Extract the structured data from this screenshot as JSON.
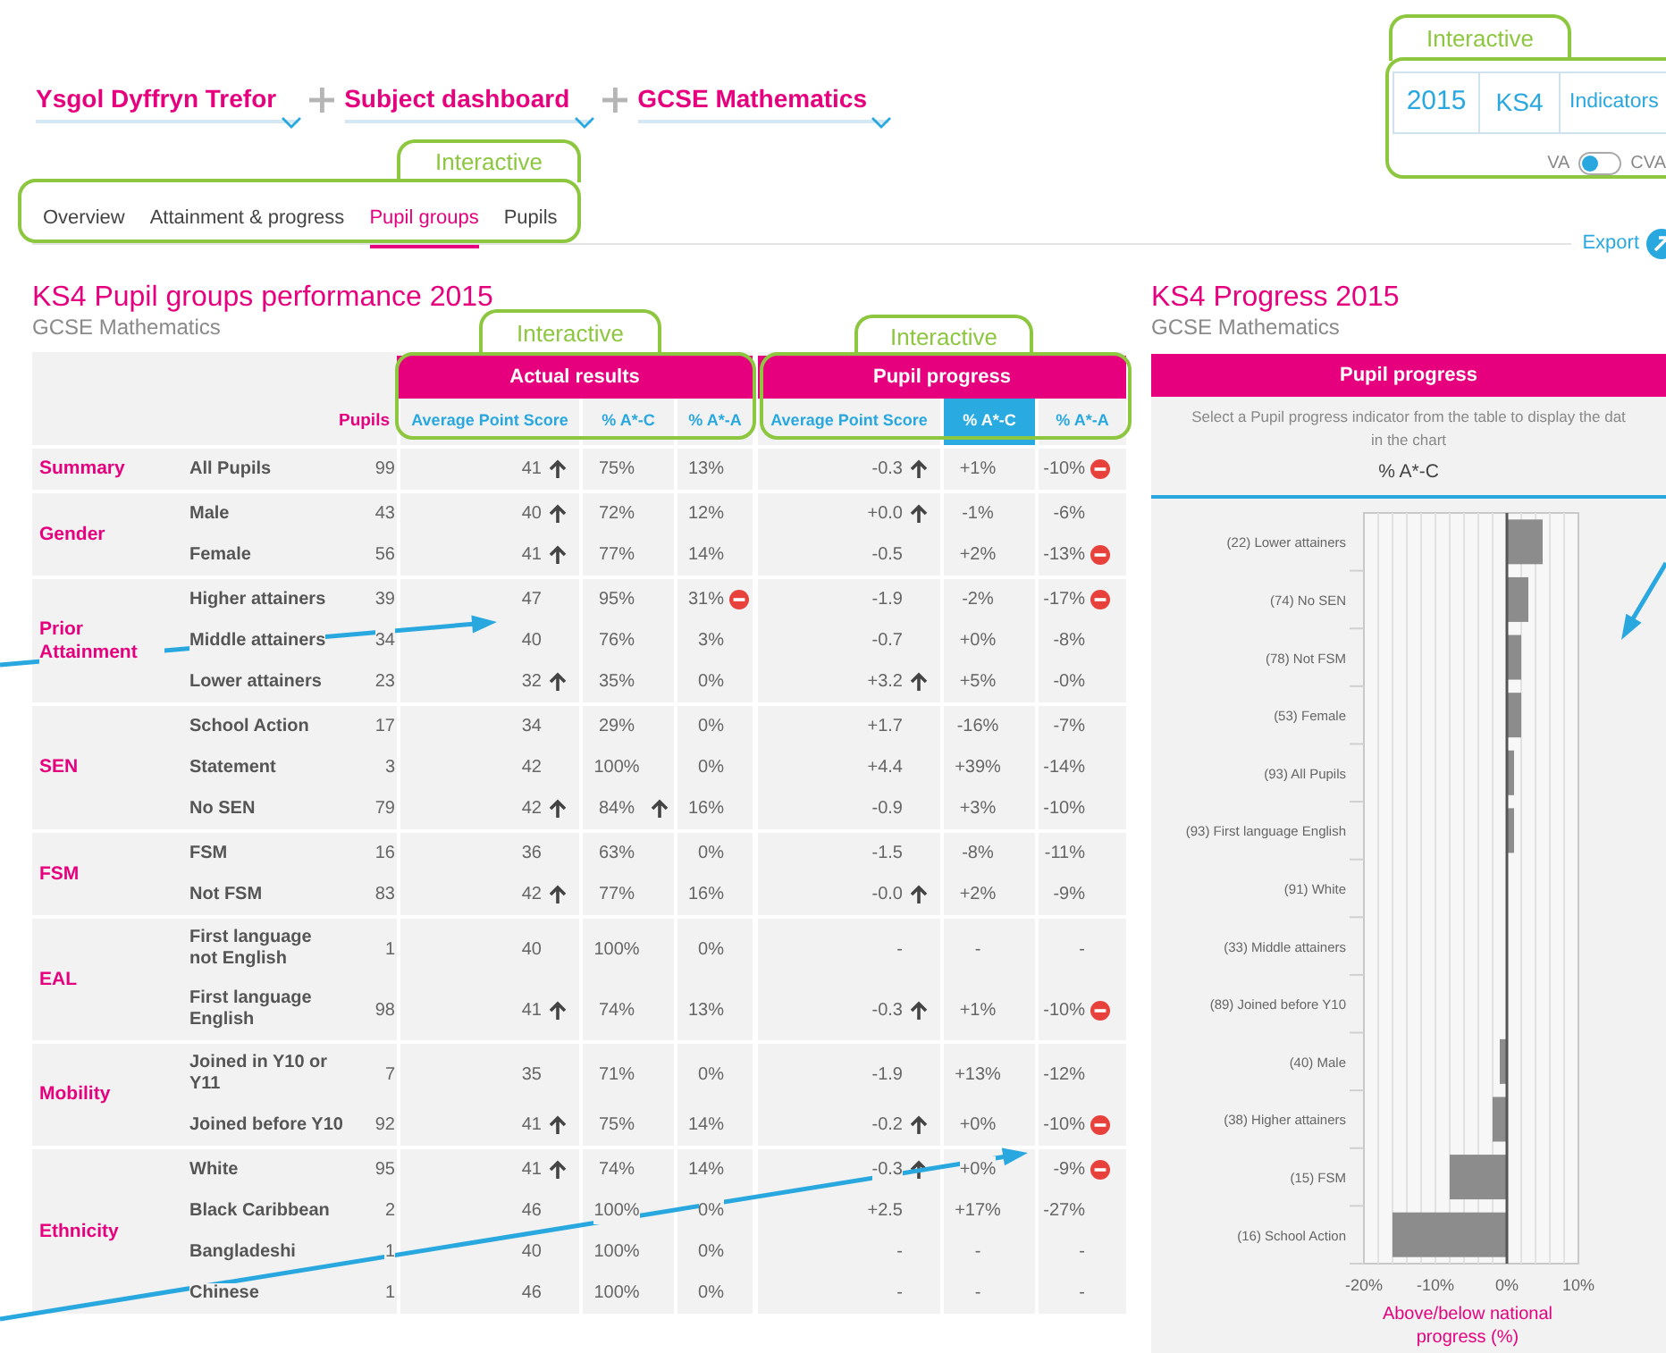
{
  "breadcrumb": [
    {
      "label": "Ysgol Dyffryn Trefor"
    },
    {
      "label": "Subject dashboard"
    },
    {
      "label": "GCSE Mathematics"
    }
  ],
  "filters": {
    "year": "2015",
    "stage": "KS4",
    "indicators": "Indicators",
    "toggle": {
      "left_label": "VA",
      "right_label": "CVA",
      "cva": false
    }
  },
  "tabs": [
    {
      "label": "Overview",
      "selected": false
    },
    {
      "label": "Attainment & progress",
      "selected": false
    },
    {
      "label": "Pupil groups",
      "selected": true
    },
    {
      "label": "Pupils",
      "selected": false
    }
  ],
  "export": "Export",
  "left_panel": {
    "title": "KS4 Pupil groups performance 2015",
    "subtitle": "GCSE Mathematics",
    "table": {
      "group_headers": [
        {
          "label": "Actual results"
        },
        {
          "label": "Pupil progress"
        }
      ],
      "pupils_header": "Pupils",
      "columns": [
        {
          "label": "Average Point Score",
          "selected": false
        },
        {
          "label": "% A*-C",
          "selected": false
        },
        {
          "label": "% A*-A",
          "selected": false
        },
        {
          "label": "Average Point Score",
          "selected": false
        },
        {
          "label": "% A*-C",
          "selected": true
        },
        {
          "label": "% A*-A",
          "selected": false
        }
      ],
      "groups": [
        {
          "label": "Summary",
          "rows": [
            {
              "name": "All Pupils",
              "pupils": "99",
              "cells": [
                {
                  "text": "41",
                  "up": true,
                  "alert": false
                },
                {
                  "text": "75%",
                  "up": false,
                  "alert": false
                },
                {
                  "text": "13%",
                  "up": false,
                  "alert": false
                },
                {
                  "text": "-0.3",
                  "up": true,
                  "alert": false
                },
                {
                  "text": "+1%",
                  "up": false,
                  "alert": false
                },
                {
                  "text": "-10%",
                  "up": false,
                  "alert": true
                }
              ]
            }
          ]
        },
        {
          "label": "Gender",
          "rows": [
            {
              "name": "Male",
              "pupils": "43",
              "cells": [
                {
                  "text": "40",
                  "up": true,
                  "alert": false
                },
                {
                  "text": "72%",
                  "up": false,
                  "alert": false
                },
                {
                  "text": "12%",
                  "up": false,
                  "alert": false
                },
                {
                  "text": "+0.0",
                  "up": true,
                  "alert": false
                },
                {
                  "text": "-1%",
                  "up": false,
                  "alert": false
                },
                {
                  "text": "-6%",
                  "up": false,
                  "alert": false
                }
              ]
            },
            {
              "name": "Female",
              "pupils": "56",
              "cells": [
                {
                  "text": "41",
                  "up": true,
                  "alert": false
                },
                {
                  "text": "77%",
                  "up": false,
                  "alert": false
                },
                {
                  "text": "14%",
                  "up": false,
                  "alert": false
                },
                {
                  "text": "-0.5",
                  "up": false,
                  "alert": false
                },
                {
                  "text": "+2%",
                  "up": false,
                  "alert": false
                },
                {
                  "text": "-13%",
                  "up": false,
                  "alert": true
                }
              ]
            }
          ]
        },
        {
          "label": "Prior Attainment",
          "rows": [
            {
              "name": "Higher attainers",
              "pupils": "39",
              "cells": [
                {
                  "text": "47",
                  "up": false,
                  "alert": false
                },
                {
                  "text": "95%",
                  "up": false,
                  "alert": false
                },
                {
                  "text": "31%",
                  "up": false,
                  "alert": true
                },
                {
                  "text": "-1.9",
                  "up": false,
                  "alert": false
                },
                {
                  "text": "-2%",
                  "up": false,
                  "alert": false
                },
                {
                  "text": "-17%",
                  "up": false,
                  "alert": true
                }
              ]
            },
            {
              "name": "Middle attainers",
              "pupils": "34",
              "cells": [
                {
                  "text": "40",
                  "up": false,
                  "alert": false
                },
                {
                  "text": "76%",
                  "up": false,
                  "alert": false
                },
                {
                  "text": "3%",
                  "up": false,
                  "alert": false
                },
                {
                  "text": "-0.7",
                  "up": false,
                  "alert": false
                },
                {
                  "text": "+0%",
                  "up": false,
                  "alert": false
                },
                {
                  "text": "-8%",
                  "up": false,
                  "alert": false
                }
              ]
            },
            {
              "name": "Lower attainers",
              "pupils": "23",
              "cells": [
                {
                  "text": "32",
                  "up": true,
                  "alert": false
                },
                {
                  "text": "35%",
                  "up": false,
                  "alert": false
                },
                {
                  "text": "0%",
                  "up": false,
                  "alert": false
                },
                {
                  "text": "+3.2",
                  "up": true,
                  "alert": false
                },
                {
                  "text": "+5%",
                  "up": false,
                  "alert": false
                },
                {
                  "text": "-0%",
                  "up": false,
                  "alert": false
                }
              ]
            }
          ]
        },
        {
          "label": "SEN",
          "rows": [
            {
              "name": "School Action",
              "pupils": "17",
              "cells": [
                {
                  "text": "34",
                  "up": false,
                  "alert": false
                },
                {
                  "text": "29%",
                  "up": false,
                  "alert": false
                },
                {
                  "text": "0%",
                  "up": false,
                  "alert": false
                },
                {
                  "text": "+1.7",
                  "up": false,
                  "alert": false
                },
                {
                  "text": "-16%",
                  "up": false,
                  "alert": false
                },
                {
                  "text": "-7%",
                  "up": false,
                  "alert": false
                }
              ]
            },
            {
              "name": "Statement",
              "pupils": "3",
              "cells": [
                {
                  "text": "42",
                  "up": false,
                  "alert": false
                },
                {
                  "text": "100%",
                  "up": false,
                  "alert": false
                },
                {
                  "text": "0%",
                  "up": false,
                  "alert": false
                },
                {
                  "text": "+4.4",
                  "up": false,
                  "alert": false
                },
                {
                  "text": "+39%",
                  "up": false,
                  "alert": false
                },
                {
                  "text": "-14%",
                  "up": false,
                  "alert": false
                }
              ]
            },
            {
              "name": "No SEN",
              "pupils": "79",
              "cells": [
                {
                  "text": "42",
                  "up": true,
                  "alert": false
                },
                {
                  "text": "84%",
                  "up": true,
                  "alert": false
                },
                {
                  "text": "16%",
                  "up": false,
                  "alert": false
                },
                {
                  "text": "-0.9",
                  "up": false,
                  "alert": false
                },
                {
                  "text": "+3%",
                  "up": false,
                  "alert": false
                },
                {
                  "text": "-10%",
                  "up": false,
                  "alert": false
                }
              ]
            }
          ]
        },
        {
          "label": "FSM",
          "rows": [
            {
              "name": "FSM",
              "pupils": "16",
              "cells": [
                {
                  "text": "36",
                  "up": false,
                  "alert": false
                },
                {
                  "text": "63%",
                  "up": false,
                  "alert": false
                },
                {
                  "text": "0%",
                  "up": false,
                  "alert": false
                },
                {
                  "text": "-1.5",
                  "up": false,
                  "alert": false
                },
                {
                  "text": "-8%",
                  "up": false,
                  "alert": false
                },
                {
                  "text": "-11%",
                  "up": false,
                  "alert": false
                }
              ]
            },
            {
              "name": "Not FSM",
              "pupils": "83",
              "cells": [
                {
                  "text": "42",
                  "up": true,
                  "alert": false
                },
                {
                  "text": "77%",
                  "up": false,
                  "alert": false
                },
                {
                  "text": "16%",
                  "up": false,
                  "alert": false
                },
                {
                  "text": "-0.0",
                  "up": true,
                  "alert": false
                },
                {
                  "text": "+2%",
                  "up": false,
                  "alert": false
                },
                {
                  "text": "-9%",
                  "up": false,
                  "alert": false
                }
              ]
            }
          ]
        },
        {
          "label": "EAL",
          "rows": [
            {
              "name": "First language not English",
              "pupils": "1",
              "cells": [
                {
                  "text": "40",
                  "up": false,
                  "alert": false
                },
                {
                  "text": "100%",
                  "up": false,
                  "alert": false
                },
                {
                  "text": "0%",
                  "up": false,
                  "alert": false
                },
                {
                  "text": "-",
                  "up": false,
                  "alert": false
                },
                {
                  "text": "-",
                  "up": false,
                  "alert": false
                },
                {
                  "text": "-",
                  "up": false,
                  "alert": false
                }
              ]
            },
            {
              "name": "First language English",
              "pupils": "98",
              "cells": [
                {
                  "text": "41",
                  "up": true,
                  "alert": false
                },
                {
                  "text": "74%",
                  "up": false,
                  "alert": false
                },
                {
                  "text": "13%",
                  "up": false,
                  "alert": false
                },
                {
                  "text": "-0.3",
                  "up": true,
                  "alert": false
                },
                {
                  "text": "+1%",
                  "up": false,
                  "alert": false
                },
                {
                  "text": "-10%",
                  "up": false,
                  "alert": true
                }
              ]
            }
          ]
        },
        {
          "label": "Mobility",
          "rows": [
            {
              "name": "Joined in Y10 or Y11",
              "pupils": "7",
              "cells": [
                {
                  "text": "35",
                  "up": false,
                  "alert": false
                },
                {
                  "text": "71%",
                  "up": false,
                  "alert": false
                },
                {
                  "text": "0%",
                  "up": false,
                  "alert": false
                },
                {
                  "text": "-1.9",
                  "up": false,
                  "alert": false
                },
                {
                  "text": "+13%",
                  "up": false,
                  "alert": false
                },
                {
                  "text": "-12%",
                  "up": false,
                  "alert": false
                }
              ]
            },
            {
              "name": "Joined before Y10",
              "pupils": "92",
              "cells": [
                {
                  "text": "41",
                  "up": true,
                  "alert": false
                },
                {
                  "text": "75%",
                  "up": false,
                  "alert": false
                },
                {
                  "text": "14%",
                  "up": false,
                  "alert": false
                },
                {
                  "text": "-0.2",
                  "up": true,
                  "alert": false
                },
                {
                  "text": "+0%",
                  "up": false,
                  "alert": false
                },
                {
                  "text": "-10%",
                  "up": false,
                  "alert": true
                }
              ]
            }
          ]
        },
        {
          "label": "Ethnicity",
          "rows": [
            {
              "name": "White",
              "pupils": "95",
              "cells": [
                {
                  "text": "41",
                  "up": true,
                  "alert": false
                },
                {
                  "text": "74%",
                  "up": false,
                  "alert": false
                },
                {
                  "text": "14%",
                  "up": false,
                  "alert": false
                },
                {
                  "text": "-0.3",
                  "up": true,
                  "alert": false
                },
                {
                  "text": "+0%",
                  "up": false,
                  "alert": false
                },
                {
                  "text": "-9%",
                  "up": false,
                  "alert": true
                }
              ]
            },
            {
              "name": "Black Caribbean",
              "pupils": "2",
              "cells": [
                {
                  "text": "46",
                  "up": false,
                  "alert": false
                },
                {
                  "text": "100%",
                  "up": false,
                  "alert": false
                },
                {
                  "text": "0%",
                  "up": false,
                  "alert": false
                },
                {
                  "text": "+2.5",
                  "up": false,
                  "alert": false
                },
                {
                  "text": "+17%",
                  "up": false,
                  "alert": false
                },
                {
                  "text": "-27%",
                  "up": false,
                  "alert": false
                }
              ]
            },
            {
              "name": "Bangladeshi",
              "pupils": "1",
              "cells": [
                {
                  "text": "40",
                  "up": false,
                  "alert": false
                },
                {
                  "text": "100%",
                  "up": false,
                  "alert": false
                },
                {
                  "text": "0%",
                  "up": false,
                  "alert": false
                },
                {
                  "text": "-",
                  "up": false,
                  "alert": false
                },
                {
                  "text": "-",
                  "up": false,
                  "alert": false
                },
                {
                  "text": "-",
                  "up": false,
                  "alert": false
                }
              ]
            },
            {
              "name": "Chinese",
              "pupils": "1",
              "cells": [
                {
                  "text": "46",
                  "up": false,
                  "alert": false
                },
                {
                  "text": "100%",
                  "up": false,
                  "alert": false
                },
                {
                  "text": "0%",
                  "up": false,
                  "alert": false
                },
                {
                  "text": "-",
                  "up": false,
                  "alert": false
                },
                {
                  "text": "-",
                  "up": false,
                  "alert": false
                },
                {
                  "text": "-",
                  "up": false,
                  "alert": false
                }
              ]
            }
          ]
        }
      ]
    }
  },
  "right_panel": {
    "title": "KS4 Progress 2015",
    "subtitle": "GCSE Mathematics",
    "header": "Pupil progress",
    "note_lines": [
      "Select a Pupil progress indicator from the table to display the dat",
      "in the chart"
    ],
    "chart_data": {
      "type": "bar",
      "orientation": "horizontal",
      "categories": [
        "(22) Lower attainers",
        "(74) No SEN",
        "(78) Not FSM",
        "(53) Female",
        "(93) All Pupils",
        "(93) First language English",
        "(91) White",
        "(33) Middle attainers",
        "(89) Joined before Y10",
        "(40) Male",
        "(38) Higher attainers",
        "(15) FSM",
        "(16) School Action"
      ],
      "series": [
        {
          "name": "% A*-C",
          "color": "#8c8c8c",
          "values": [
            5,
            3,
            2,
            2,
            1,
            1,
            0,
            0,
            0,
            -1,
            -2,
            -8,
            -16
          ]
        }
      ],
      "xlim": [
        -20,
        10
      ],
      "xticks": [
        {
          "value": -20,
          "label": "-20%"
        },
        {
          "value": -10,
          "label": "-10%"
        },
        {
          "value": 0,
          "label": "0%"
        },
        {
          "value": 10,
          "label": "10%"
        }
      ],
      "xlabel": "Above/below national progress (%)"
    }
  },
  "annotations": {
    "callouts": [
      {
        "label": "Interactive"
      },
      {
        "label": "Interactive"
      },
      {
        "label": "Interactive"
      },
      {
        "label": "Interactive"
      }
    ]
  }
}
